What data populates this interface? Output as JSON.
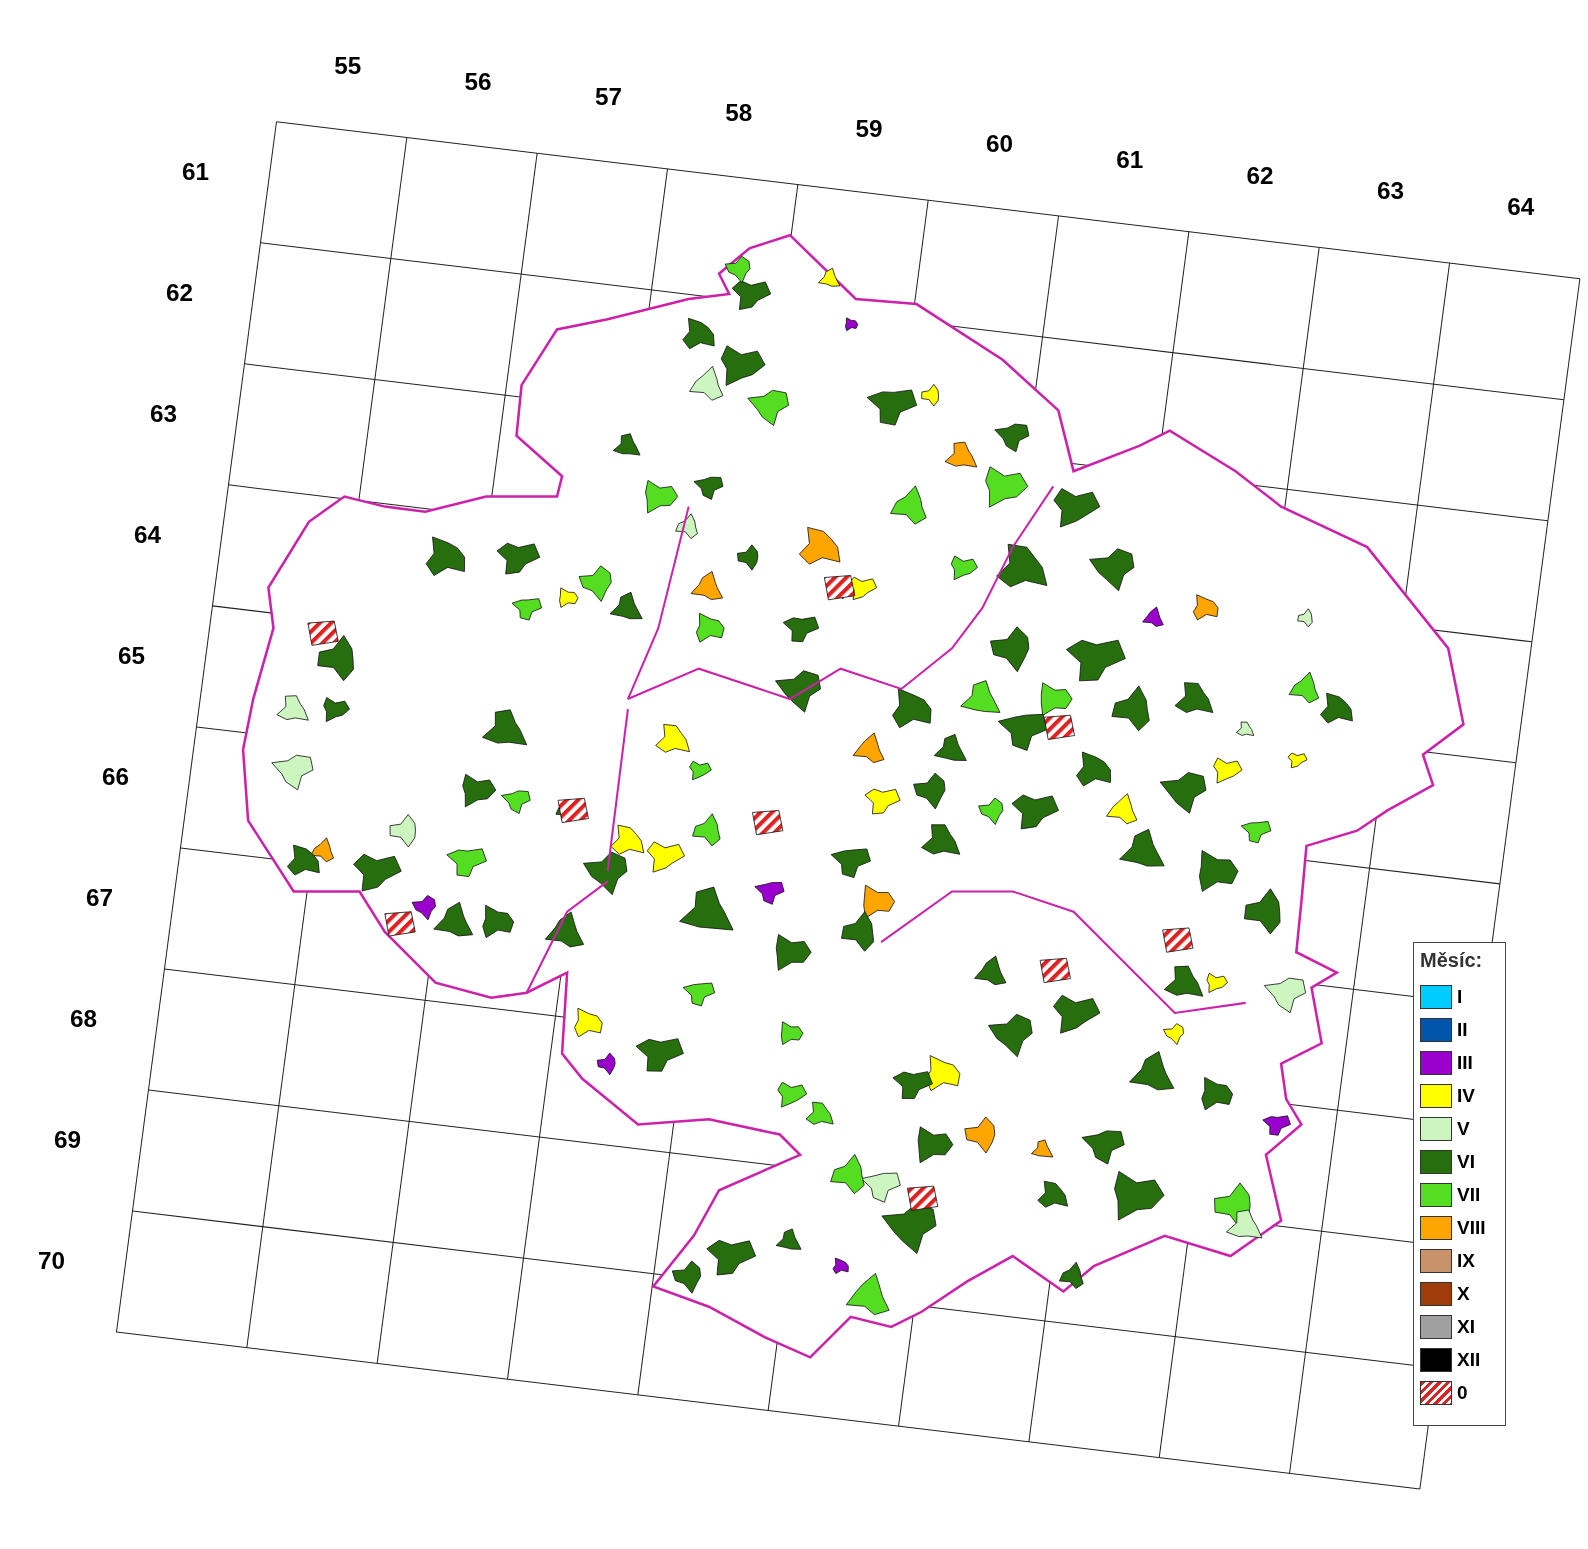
{
  "grid": {
    "column_labels": [
      "55",
      "56",
      "57",
      "58",
      "59",
      "60",
      "61",
      "62",
      "63",
      "64"
    ],
    "row_labels": [
      "61",
      "62",
      "63",
      "64",
      "65",
      "66",
      "67",
      "68",
      "69",
      "70"
    ]
  },
  "legend": {
    "title": "Měsíc:",
    "items": [
      {
        "label": "I",
        "kind": "solid",
        "color": "#00ccff"
      },
      {
        "label": "II",
        "kind": "solid",
        "color": "#0055aa"
      },
      {
        "label": "III",
        "kind": "solid",
        "color": "#9900cc"
      },
      {
        "label": "IV",
        "kind": "solid",
        "color": "#ffff00"
      },
      {
        "label": "V",
        "kind": "solid",
        "color": "#ccf5c0"
      },
      {
        "label": "VI",
        "kind": "solid",
        "color": "#276e0e"
      },
      {
        "label": "VII",
        "kind": "solid",
        "color": "#55dd22"
      },
      {
        "label": "VIII",
        "kind": "solid",
        "color": "#ffa500"
      },
      {
        "label": "IX",
        "kind": "solid",
        "color": "#c8926a"
      },
      {
        "label": "X",
        "kind": "solid",
        "color": "#a03c0a"
      },
      {
        "label": "XI",
        "kind": "solid",
        "color": "#a0a0a0"
      },
      {
        "label": "XII",
        "kind": "solid",
        "color": "#000000"
      },
      {
        "label": "0",
        "kind": "hatched",
        "color": "#dd2222"
      }
    ]
  }
}
